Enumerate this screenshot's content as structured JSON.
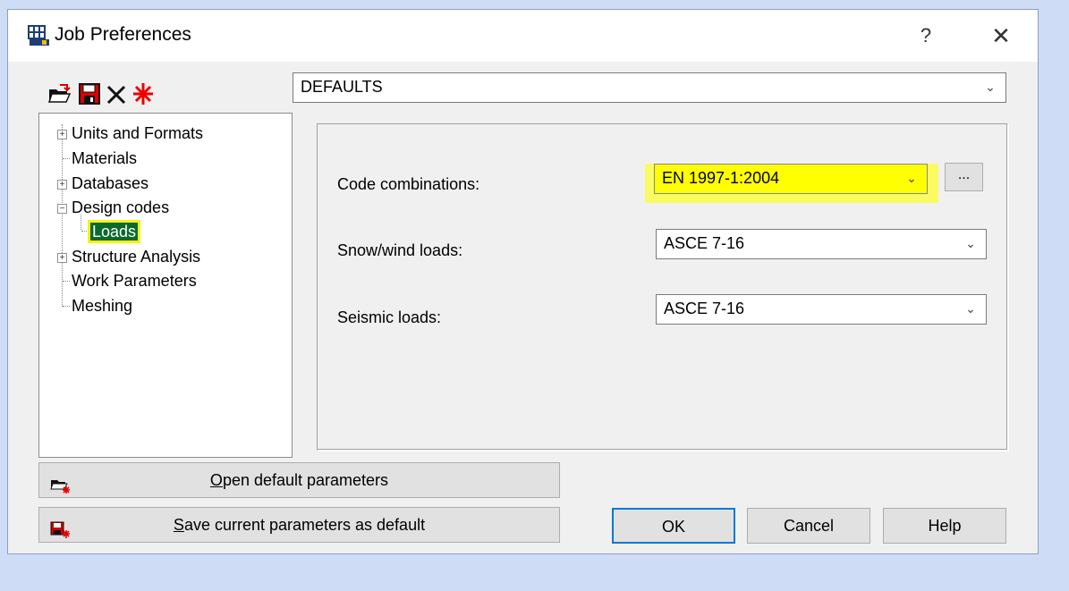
{
  "window": {
    "title": "Job Preferences",
    "help_glyph": "?",
    "close_glyph": "✕"
  },
  "toolbar": {
    "icons": [
      "open-folder-icon",
      "save-disk-icon",
      "delete-x-icon",
      "reset-star-icon"
    ]
  },
  "profile": {
    "selected": "DEFAULTS"
  },
  "tree": {
    "items": [
      {
        "label": "Units and Formats",
        "expander": "+"
      },
      {
        "label": "Materials"
      },
      {
        "label": "Databases",
        "expander": "+"
      },
      {
        "label": "Design codes",
        "expander": "−"
      },
      {
        "label": "Loads",
        "selected": true
      },
      {
        "label": "Structure Analysis",
        "expander": "+"
      },
      {
        "label": "Work Parameters"
      },
      {
        "label": "Meshing"
      }
    ]
  },
  "panel": {
    "code_combinations": {
      "label": "Code combinations:",
      "value": "EN 1997-1:2004",
      "more": "..."
    },
    "snow_wind": {
      "label": "Snow/wind loads:",
      "value": "ASCE 7-16"
    },
    "seismic": {
      "label": "Seismic loads:",
      "value": "ASCE 7-16"
    }
  },
  "buttons": {
    "open_default_accel": "O",
    "open_default_rest": "pen default parameters",
    "save_default_accel": "S",
    "save_default_rest": "ave current parameters as default",
    "ok": "OK",
    "cancel": "Cancel",
    "help": "Help"
  },
  "colors": {
    "highlight": "#ffff00",
    "selection": "#0a6a2c",
    "default_button_border": "#0078d7"
  }
}
